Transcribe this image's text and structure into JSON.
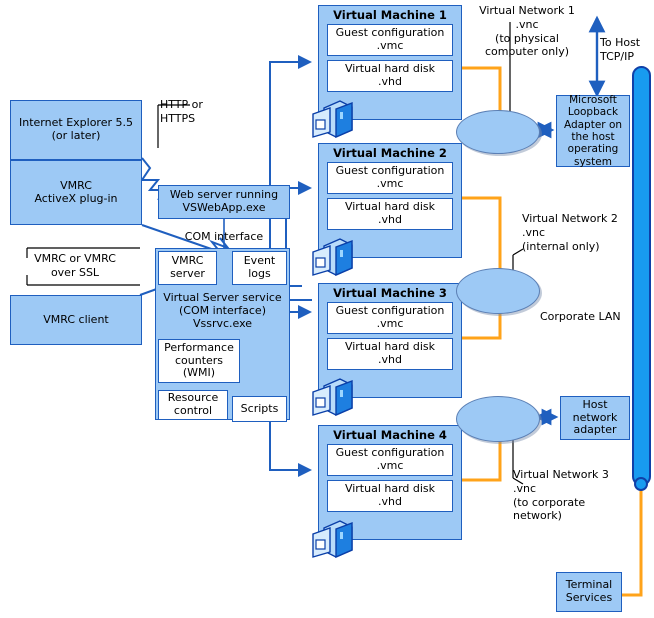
{
  "title": "Virtual Server architecture diagram",
  "colors": {
    "box_fill": "#9DC9F5",
    "box_border": "#1F5FBF",
    "connector_blue": "#1F5FBF",
    "connector_orange": "#FFA31A",
    "lan_bar": "#189BF0",
    "lan_border": "#1040A8"
  },
  "client_stack": {
    "browser": "Internet Explorer 5.5\n(or later)",
    "plugin": "VMRC\nActiveX plug-in",
    "vmrc_client": "VMRC client"
  },
  "labels": {
    "http": "HTTP or\nHTTPS",
    "vmrc_ssl": "VMRC or VMRC\nover SSL",
    "com_interface": "COM interface",
    "corporate_lan": "Corporate LAN",
    "to_host": "To Host\nTCP/IP"
  },
  "server_stack": {
    "web_server": "Web server running\nVSWebApp.exe",
    "vmrc_server": "VMRC\nserver",
    "event_logs": "Event\nlogs",
    "vs_service": "Virtual Server service\n(COM interface)\nVssrvc.exe",
    "perf_counters": "Performance\ncounters\n(WMI)",
    "resource_control": "Resource\ncontrol",
    "scripts": "Scripts"
  },
  "vm_common": {
    "guest_config": "Guest configuration\n.vmc",
    "hard_disk": "Virtual hard disk\n.vhd"
  },
  "virtual_machines": [
    {
      "title": "Virtual Machine 1"
    },
    {
      "title": "Virtual Machine 2"
    },
    {
      "title": "Virtual Machine 3"
    },
    {
      "title": "Virtual Machine 4"
    }
  ],
  "networks": [
    {
      "name": "Virtual Network 1\n.vnc\n(to physical\ncomputer only)"
    },
    {
      "name": "Virtual Network 2\n.vnc\n(internal only)"
    },
    {
      "name": "Virtual Network 3\n.vnc\n(to corporate\nnetwork)"
    }
  ],
  "host_components": {
    "loopback_adapter": "Microsoft\nLoopback\nAdapter on\nthe host\noperating\nsystem",
    "host_network_adapter": "Host\nnetwork\nadapter",
    "terminal_services": "Terminal\nServices"
  },
  "icons": {
    "computer": "computer-tower-icon"
  }
}
